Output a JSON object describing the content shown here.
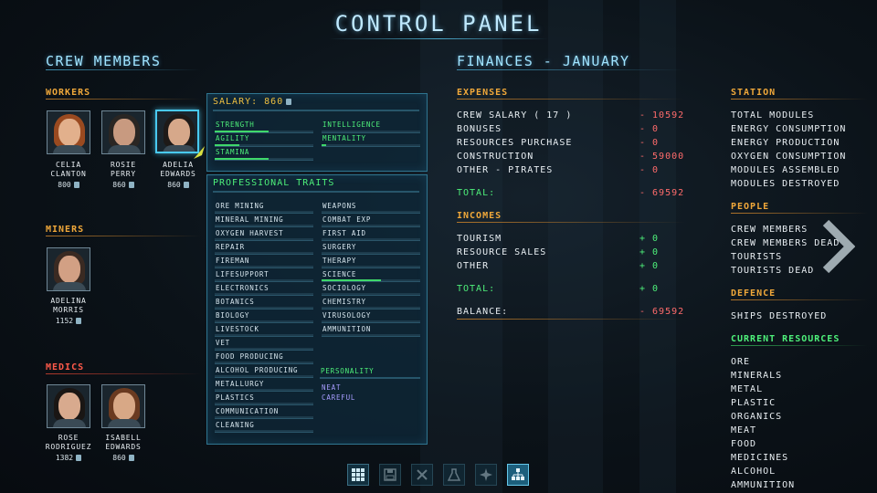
{
  "title": "Control Panel",
  "crew": {
    "heading": "Crew Members",
    "workers_label": "Workers",
    "miners_label": "Miners",
    "medics_label": "Medics",
    "workers": [
      {
        "name1": "Celia",
        "name2": "Clanton",
        "salary": "800"
      },
      {
        "name1": "Rosie",
        "name2": "Perry",
        "salary": "860"
      },
      {
        "name1": "Adelia",
        "name2": "Edwards",
        "salary": "860"
      }
    ],
    "miners": [
      {
        "name1": "Adelina",
        "name2": "Morris",
        "salary": "1152"
      }
    ],
    "medics": [
      {
        "name1": "Rose",
        "name2": "Rodriguez",
        "salary": "1382"
      },
      {
        "name1": "Isabell",
        "name2": "Edwards",
        "salary": "860"
      }
    ]
  },
  "detail": {
    "salary_label": "Salary: 860",
    "stats": [
      {
        "label": "Strength",
        "level": 0.55
      },
      {
        "label": "Intelligence",
        "level": 0.0
      },
      {
        "label": "Agility",
        "level": 0.25
      },
      {
        "label": "Mentality",
        "level": 0.05
      },
      {
        "label": "Stamina",
        "level": 0.55
      }
    ],
    "traits_title": "Professional Traits",
    "traits_left": [
      "Ore Mining",
      "Mineral Mining",
      "Oxygen Harvest",
      "Repair",
      "Fireman",
      "Lifesupport",
      "Electronics",
      "Botanics",
      "Biology",
      "Livestock",
      "Vet",
      "Food Producing",
      "Alcohol Producing",
      "Metallurgy",
      "Plastics",
      "Communication",
      "Cleaning"
    ],
    "traits_right": [
      "Weapons",
      "Combat Exp",
      "First Aid",
      "Surgery",
      "Therapy",
      "Science",
      "Sociology",
      "Chemistry",
      "Virusology",
      "Ammunition"
    ],
    "science_level": 0.6,
    "personality_title": "Personality",
    "personality": [
      "Neat",
      "Careful"
    ]
  },
  "finances": {
    "heading": "Finances - January",
    "expenses_label": "Expenses",
    "expenses": [
      {
        "label": "Crew Salary ( 17 )",
        "value": "- 10592"
      },
      {
        "label": "Bonuses",
        "value": "- 0"
      },
      {
        "label": "Resources Purchase",
        "value": "- 0"
      },
      {
        "label": "Construction",
        "value": "- 59000"
      },
      {
        "label": "Other - Pirates",
        "value": "- 0"
      }
    ],
    "expenses_total_label": "Total:",
    "expenses_total": "- 69592",
    "incomes_label": "Incomes",
    "incomes": [
      {
        "label": "Tourism",
        "value": "+ 0"
      },
      {
        "label": "Resource Sales",
        "value": "+ 0"
      },
      {
        "label": "Other",
        "value": "+ 0"
      }
    ],
    "incomes_total_label": "Total:",
    "incomes_total": "+ 0",
    "balance_label": "Balance:",
    "balance": "- 69592"
  },
  "station": {
    "station_label": "Station",
    "station_items": [
      "Total Modules",
      "Energy Consumption",
      "Energy Production",
      "Oxygen Consumption",
      "Modules Assembled",
      "Modules Destroyed"
    ],
    "people_label": "People",
    "people_items": [
      "Crew Members",
      "Crew Members Dead",
      "Tourists",
      "Tourists Dead"
    ],
    "defence_label": "Defence",
    "defence_items": [
      "Ships Destroyed"
    ],
    "resources_label": "Current Resources",
    "resources_items": [
      "Ore",
      "Minerals",
      "Metal",
      "Plastic",
      "Organics",
      "Meat",
      "Food",
      "Medicines",
      "Alcohol",
      "Ammunition"
    ]
  },
  "toolbar": [
    "grid-icon",
    "save-icon",
    "tools-icon",
    "flask-icon",
    "plane-icon",
    "hierarchy-icon"
  ],
  "colors": {
    "accent": "#49c9f0",
    "positive": "#4ef07a",
    "negative": "#ff6b6b",
    "workers": "#f0a83a",
    "medics": "#ff5a4a"
  }
}
